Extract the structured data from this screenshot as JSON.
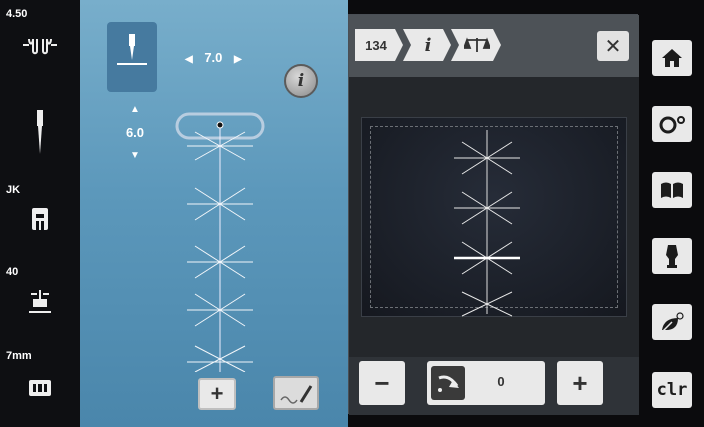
{
  "status": {
    "tension_value": "4.50",
    "presser_label": "JK",
    "pressure_value": "40",
    "plate_label": "7mm"
  },
  "stitch": {
    "width_value": "7.0",
    "length_value": "6.0"
  },
  "info_panel": {
    "stitch_number": "134",
    "info_glyph": "i",
    "balance_label": "",
    "offset_value": "0",
    "close_icon": "close-icon"
  },
  "right_bar": {
    "home_icon": "home-icon",
    "setup_icon": "setup-icon",
    "tutorial_icon": "tutorial-icon",
    "consultant_icon": "sewing-consultant-icon",
    "eco_icon": "eco-icon",
    "clr_label": "clr"
  },
  "colors": {
    "center_bg": "#5c98bb",
    "panel_bg": "#2f3338",
    "button_bg": "#e9e9e9"
  }
}
